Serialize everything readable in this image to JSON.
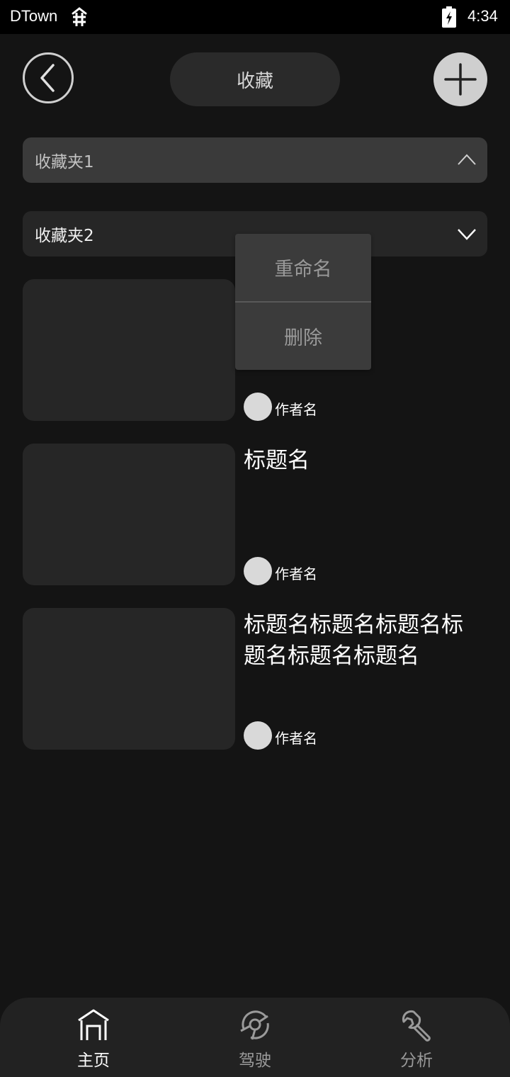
{
  "status_bar": {
    "carrier": "DTown",
    "time": "4:34"
  },
  "header": {
    "title": "收藏"
  },
  "folders": [
    {
      "name": "收藏夹1",
      "expanded": true
    },
    {
      "name": "收藏夹2",
      "expanded": false
    }
  ],
  "context_menu": {
    "items": [
      "重命名",
      "删除"
    ]
  },
  "posts": [
    {
      "title": "",
      "author": "作者名"
    },
    {
      "title": "标题名",
      "author": "作者名"
    },
    {
      "title": "标题名标题名标题名标题名标题名标题名",
      "author": "作者名"
    }
  ],
  "bottom_nav": {
    "items": [
      {
        "label": "主页",
        "icon": "home-icon",
        "active": true
      },
      {
        "label": "驾驶",
        "icon": "steering-wheel-icon",
        "active": false
      },
      {
        "label": "分析",
        "icon": "wrench-icon",
        "active": false
      }
    ]
  },
  "colors": {
    "background": "#141414",
    "surface": "#262626",
    "active_nav": "#ffffff",
    "inactive_nav": "#9a9a9a"
  }
}
